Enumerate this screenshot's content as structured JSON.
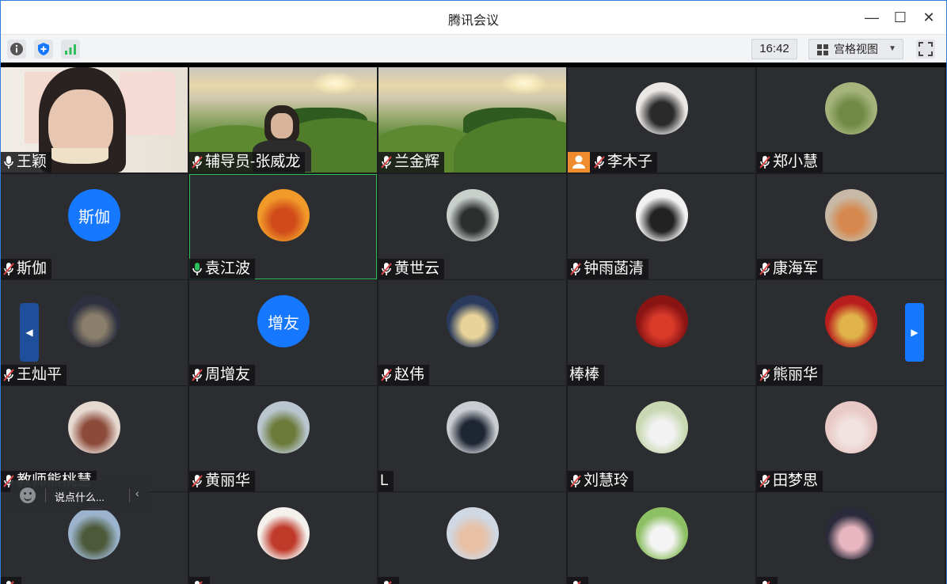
{
  "window": {
    "title": "腾讯会议",
    "minimize": "—",
    "maximize": "☐",
    "close": "✕"
  },
  "toolbar": {
    "clock": "16:42",
    "view_label": "宫格视图",
    "view_caret": "▼"
  },
  "participants": [
    {
      "name": "王颖",
      "mic": "on",
      "media": "video-woman"
    },
    {
      "name": "辅导员-张威龙",
      "mic": "muted",
      "media": "video-man"
    },
    {
      "name": "兰金辉",
      "mic": "muted",
      "media": "landscape"
    },
    {
      "name": "李木子",
      "mic": "muted",
      "media": "avatar",
      "host_badge": true
    },
    {
      "name": "郑小慧",
      "mic": "muted",
      "media": "avatar"
    },
    {
      "name": "斯伽",
      "mic": "muted",
      "media": "text-avatar",
      "avatar_text": "斯伽"
    },
    {
      "name": "袁江波",
      "mic": "speaking",
      "media": "avatar",
      "selected": true
    },
    {
      "name": "黄世云",
      "mic": "muted",
      "media": "avatar"
    },
    {
      "name": "钟雨菡清",
      "mic": "muted",
      "media": "avatar"
    },
    {
      "name": "康海军",
      "mic": "muted",
      "media": "avatar"
    },
    {
      "name": "王灿平",
      "mic": "muted",
      "media": "avatar"
    },
    {
      "name": "周增友",
      "mic": "muted",
      "media": "text-avatar",
      "avatar_text": "增友"
    },
    {
      "name": "赵伟",
      "mic": "muted",
      "media": "avatar"
    },
    {
      "name": "棒棒",
      "mic": "none",
      "media": "avatar"
    },
    {
      "name": "熊丽华",
      "mic": "muted",
      "media": "avatar"
    },
    {
      "name": "教师熊桃慧",
      "mic": "muted",
      "media": "avatar"
    },
    {
      "name": "黄丽华",
      "mic": "muted",
      "media": "avatar"
    },
    {
      "name": "L",
      "mic": "none",
      "media": "avatar"
    },
    {
      "name": "刘慧玲",
      "mic": "muted",
      "media": "avatar"
    },
    {
      "name": "田梦思",
      "mic": "muted",
      "media": "avatar"
    },
    {
      "name": "",
      "mic": "muted",
      "media": "avatar"
    },
    {
      "name": "",
      "mic": "muted",
      "media": "avatar"
    },
    {
      "name": "",
      "mic": "muted",
      "media": "avatar"
    },
    {
      "name": "",
      "mic": "muted",
      "media": "avatar"
    },
    {
      "name": "",
      "mic": "muted",
      "media": "avatar"
    }
  ],
  "chat": {
    "placeholder": "说点什么...",
    "collapse": "‹"
  },
  "nav": {
    "prev": "◀",
    "next": "▶"
  },
  "colors": {
    "accent": "#1677ff",
    "tile_bg": "#2b2d31",
    "speaking": "#2fbf5a",
    "muted": "#e04848",
    "host_badge": "#f08c2e"
  }
}
